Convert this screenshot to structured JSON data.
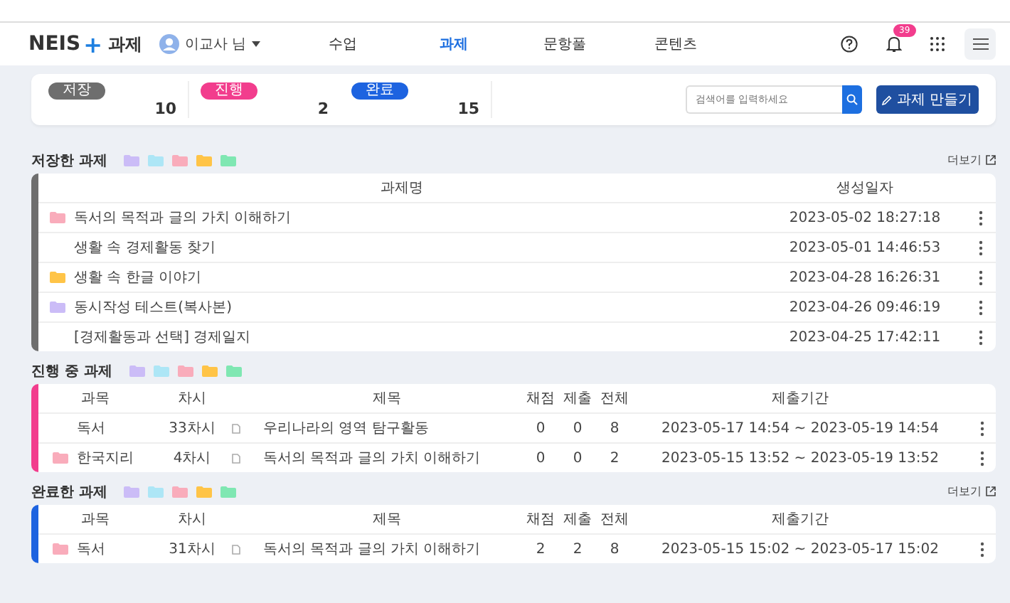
{
  "header": {
    "logo": "NEIS",
    "logo_plus": "+",
    "logo_suffix": "과제",
    "user": "이교사 님",
    "nav": [
      {
        "label": "수업",
        "selected": false
      },
      {
        "label": "과제",
        "selected": true
      },
      {
        "label": "문항풀",
        "selected": false
      },
      {
        "label": "콘텐츠",
        "selected": false
      }
    ],
    "notification_count": "39"
  },
  "summary": {
    "stats": [
      {
        "label": "저장",
        "count": "10",
        "color": "#6e6e6e"
      },
      {
        "label": "진행",
        "count": "2",
        "color": "#f23d8d"
      },
      {
        "label": "완료",
        "count": "15",
        "color": "#1d63e0"
      }
    ],
    "search": {
      "placeholder": "검색어를 입력하세요"
    },
    "create_button": "과제 만들기"
  },
  "sections": [
    {
      "kind": "saved",
      "title": "저장한 과제",
      "color": "#6e6e6e",
      "more": "더보기",
      "folders": [
        {
          "color": "#cbbcf7"
        },
        {
          "color": "#ade6f6"
        },
        {
          "color": "#f9acbb"
        },
        {
          "color": "#ffc447"
        },
        {
          "color": "#7fe7b2"
        }
      ],
      "columns": [
        "과제명",
        "생성일자"
      ],
      "rows": [
        {
          "color": "#f9acbb",
          "title": "독서의 목적과 글의 가치 이해하기",
          "date": "2023-05-02 18:27:18"
        },
        {
          "title": "생활 속 경제활동 찾기",
          "date": "2023-05-01 14:46:53"
        },
        {
          "color": "#ffc447",
          "title": "생활 속 한글 이야기",
          "date": "2023-04-28 16:26:31"
        },
        {
          "color": "#cbbcf7",
          "title": "동시작성 테스트(복사본)",
          "date": "2023-04-26 09:46:19"
        },
        {
          "title": "[경제활동과 선택] 경제일지",
          "date": "2023-04-25 17:42:11"
        }
      ]
    },
    {
      "kind": "assignments",
      "title": "진행 중 과제",
      "color": "#f23d8d",
      "folders": [
        {
          "color": "#cbbcf7"
        },
        {
          "color": "#ade6f6"
        },
        {
          "color": "#f9acbb"
        },
        {
          "color": "#ffc447"
        },
        {
          "color": "#7fe7b2"
        }
      ],
      "columns": [
        "과목",
        "차시",
        "제목",
        "채점",
        "제출",
        "전체",
        "제출기간"
      ],
      "rows": [
        {
          "subject": "독서",
          "session": "33차시",
          "title": "우리나라의 영역 탐구활동",
          "graded": "0",
          "submitted": "0",
          "total": "8",
          "period": "2023-05-17 14:54 ~ 2023-05-19 14:54"
        },
        {
          "color": "#f9acbb",
          "subject": "한국지리",
          "session": "4차시",
          "title": "독서의 목적과 글의 가치 이해하기",
          "graded": "0",
          "submitted": "0",
          "total": "2",
          "period": "2023-05-15 13:52 ~ 2023-05-19 13:52"
        }
      ]
    },
    {
      "kind": "assignments",
      "title": "완료한 과제",
      "color": "#1d63e0",
      "more": "더보기",
      "folders": [
        {
          "color": "#cbbcf7"
        },
        {
          "color": "#ade6f6"
        },
        {
          "color": "#f9acbb"
        },
        {
          "color": "#ffc447"
        },
        {
          "color": "#7fe7b2"
        }
      ],
      "columns": [
        "과목",
        "차시",
        "제목",
        "채점",
        "제출",
        "전체",
        "제출기간"
      ],
      "rows": [
        {
          "color": "#f9acbb",
          "subject": "독서",
          "session": "31차시",
          "title": "독서의 목적과 글의 가치 이해하기",
          "graded": "2",
          "submitted": "2",
          "total": "8",
          "period": "2023-05-15 15:02 ~ 2023-05-17 15:02"
        }
      ]
    }
  ]
}
